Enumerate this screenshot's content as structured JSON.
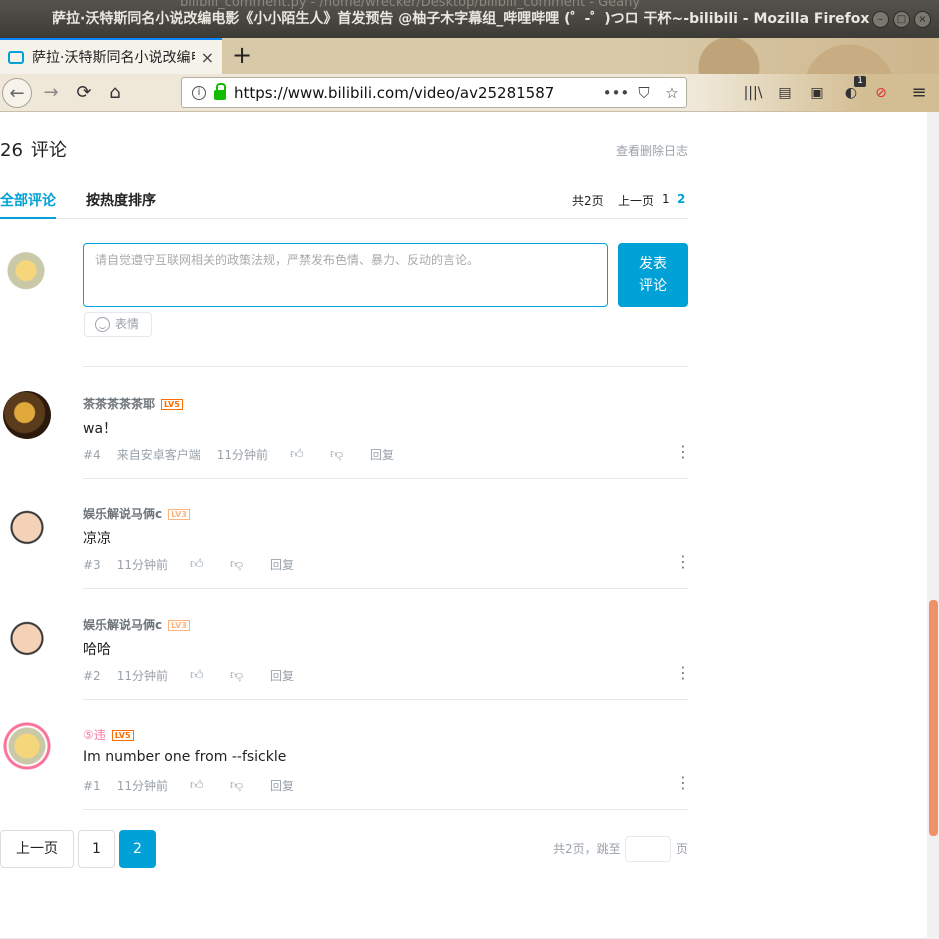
{
  "window": {
    "ghost_title": "bilibili_comment.py - /home/wrecker/Desktop/bilibili_comment - Geany",
    "title": "萨拉·沃特斯同名小说改编电影《小小陌生人》首发预告 @柚子木字幕组_哔哩哔哩 (゜-゜)つロ 干杯~-bilibili - Mozilla Firefox"
  },
  "tab": {
    "label": "萨拉·沃特斯同名小说改编电",
    "close": "×",
    "new_tab": "+"
  },
  "nav": {
    "back": "←",
    "forward": "→",
    "reload": "⟳",
    "home": "⌂",
    "url": "https://www.bilibili.com/video/av25281587",
    "page_actions": "•••",
    "pocket": "⛉",
    "star": "☆",
    "library": "|||\\",
    "reader": "▤",
    "extension_badge": "1",
    "menu": "≡"
  },
  "comments_header": {
    "count": "26",
    "title": "评论",
    "delete_log": "查看删除日志"
  },
  "tabs": {
    "all": "全部评论",
    "hot": "按热度排序",
    "total_pages": "共2页",
    "prev": "上一页",
    "page1": "1",
    "page2": "2"
  },
  "composer": {
    "placeholder": "请自觉遵守互联网相关的政策法规，严禁发布色情、暴力、反动的言论。",
    "send_line1": "发表",
    "send_line2": "评论",
    "emoji": "表情"
  },
  "comments": [
    {
      "user": "茶茶茶茶茶耶",
      "level": "LV5",
      "text": "wa！",
      "floor": "#4",
      "source": "来自安卓客户端",
      "time": "11分钟前",
      "reply": "回复"
    },
    {
      "user": "娱乐解说马俩c",
      "level": "LV3",
      "text": "凉凉",
      "floor": "#3",
      "time": "11分钟前",
      "reply": "回复"
    },
    {
      "user": "娱乐解说马俩c",
      "level": "LV3",
      "text": "哈哈",
      "floor": "#2",
      "time": "11分钟前",
      "reply": "回复"
    },
    {
      "user": "⑤违",
      "level": "LV5",
      "text": "Im number one from --fsickle",
      "floor": "#1",
      "time": "11分钟前",
      "reply": "回复"
    }
  ],
  "pagination": {
    "prev": "上一页",
    "page1": "1",
    "page2": "2",
    "jump_label": "共2页，跳至",
    "jump_unit": "页"
  },
  "colors": {
    "accent": "#00a1d6",
    "level5": "#ff6c00",
    "level3": "#ffb37c",
    "vip_pink": "#fb7299",
    "scroll_thumb": "#f0916a"
  }
}
